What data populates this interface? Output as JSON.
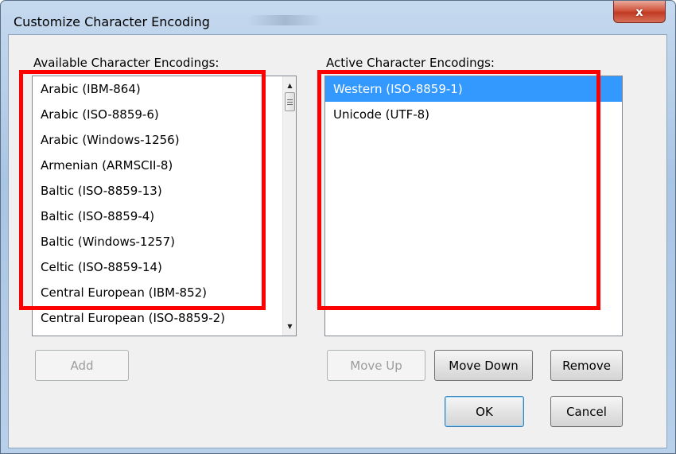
{
  "window": {
    "title": "Customize Character Encoding",
    "close_glyph": "x"
  },
  "available": {
    "label": "Available Character Encodings:",
    "items": [
      "Arabic (IBM-864)",
      "Arabic (ISO-8859-6)",
      "Arabic (Windows-1256)",
      "Armenian (ARMSCII-8)",
      "Baltic (ISO-8859-13)",
      "Baltic (ISO-8859-4)",
      "Baltic (Windows-1257)",
      "Celtic (ISO-8859-14)",
      "Central European (IBM-852)",
      "Central European (ISO-8859-2)"
    ],
    "scroll_up_glyph": "▲",
    "scroll_down_glyph": "▼"
  },
  "active": {
    "label": "Active Character Encodings:",
    "items": [
      "Western (ISO-8859-1)",
      "Unicode (UTF-8)"
    ],
    "selected_index": 0
  },
  "buttons": {
    "add": "Add",
    "move_up": "Move Up",
    "move_down": "Move Down",
    "remove": "Remove",
    "ok": "OK",
    "cancel": "Cancel"
  },
  "colors": {
    "selection": "#3399ff",
    "highlight_box": "#ff0000"
  }
}
